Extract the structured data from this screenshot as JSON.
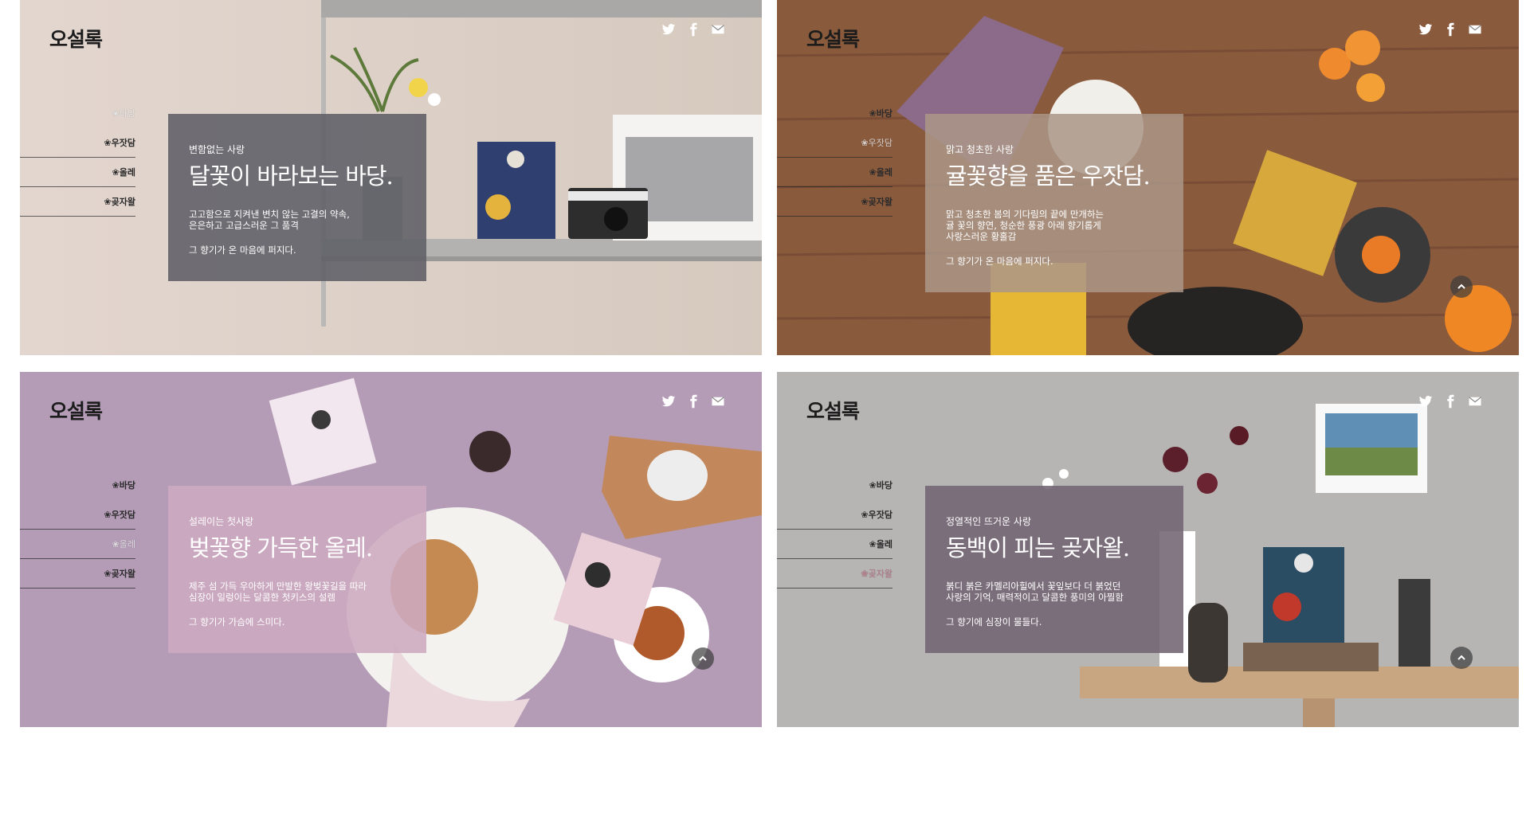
{
  "brand": "오설록",
  "social_icons": [
    "twitter-icon",
    "facebook-icon",
    "mail-icon"
  ],
  "nav_labels": [
    "바당",
    "우잣담",
    "올레",
    "곶자왈"
  ],
  "panels": [
    {
      "active_nav": 0,
      "card": {
        "sub": "변함없는 사랑",
        "title": "달꽃이 바라보는 바당.",
        "desc": [
          "고고함으로 지켜낸 변치 않는 고결의 약속,",
          "은은하고 고급스러운 그 품격"
        ],
        "tail": "그 향기가 온 마음에 퍼지다."
      },
      "colors": {
        "bg": "#d8cdc4",
        "card": "#6b6a70"
      }
    },
    {
      "active_nav": 1,
      "card": {
        "sub": "맑고 청초한 사랑",
        "title": "귤꽃향을 품은 우잣담.",
        "desc": [
          "맑고 청초한 봄의 기다림의 끝에 만개하는",
          "귤 꽃의 향연, 청순한 풍광 아래 향기롭게",
          "사랑스러운 황홀감"
        ],
        "tail": "그 향기가 온 마음에 퍼지다."
      },
      "colors": {
        "bg": "#8f5f42",
        "card": "#9e8a7c"
      }
    },
    {
      "active_nav": 2,
      "card": {
        "sub": "설레이는 첫사랑",
        "title": "벚꽃향 가득한 올레.",
        "desc": [
          "제주 섬 가득 우아하게 만발한 왕벚꽃길을 따라",
          "심장이 일렁이는 달콤한 첫키스의 설렘"
        ],
        "tail": "그 향기가 가슴에 스미다."
      },
      "colors": {
        "bg": "#b39bb6",
        "card": "#c9a9bd"
      }
    },
    {
      "active_nav": 3,
      "card": {
        "sub": "정열적인 뜨거운 사랑",
        "title": "동백이 피는 곶자왈.",
        "desc": [
          "붉디 붉은 카멜리아힐에서 꽃잎보다 더 붉었던",
          "사랑의 기억, 매력적이고 달콤한 풍미의 아찔함"
        ],
        "tail": "그 향기에 심장이 물들다."
      },
      "colors": {
        "bg": "#b9b7b6",
        "card": "#7a6b78"
      }
    }
  ]
}
